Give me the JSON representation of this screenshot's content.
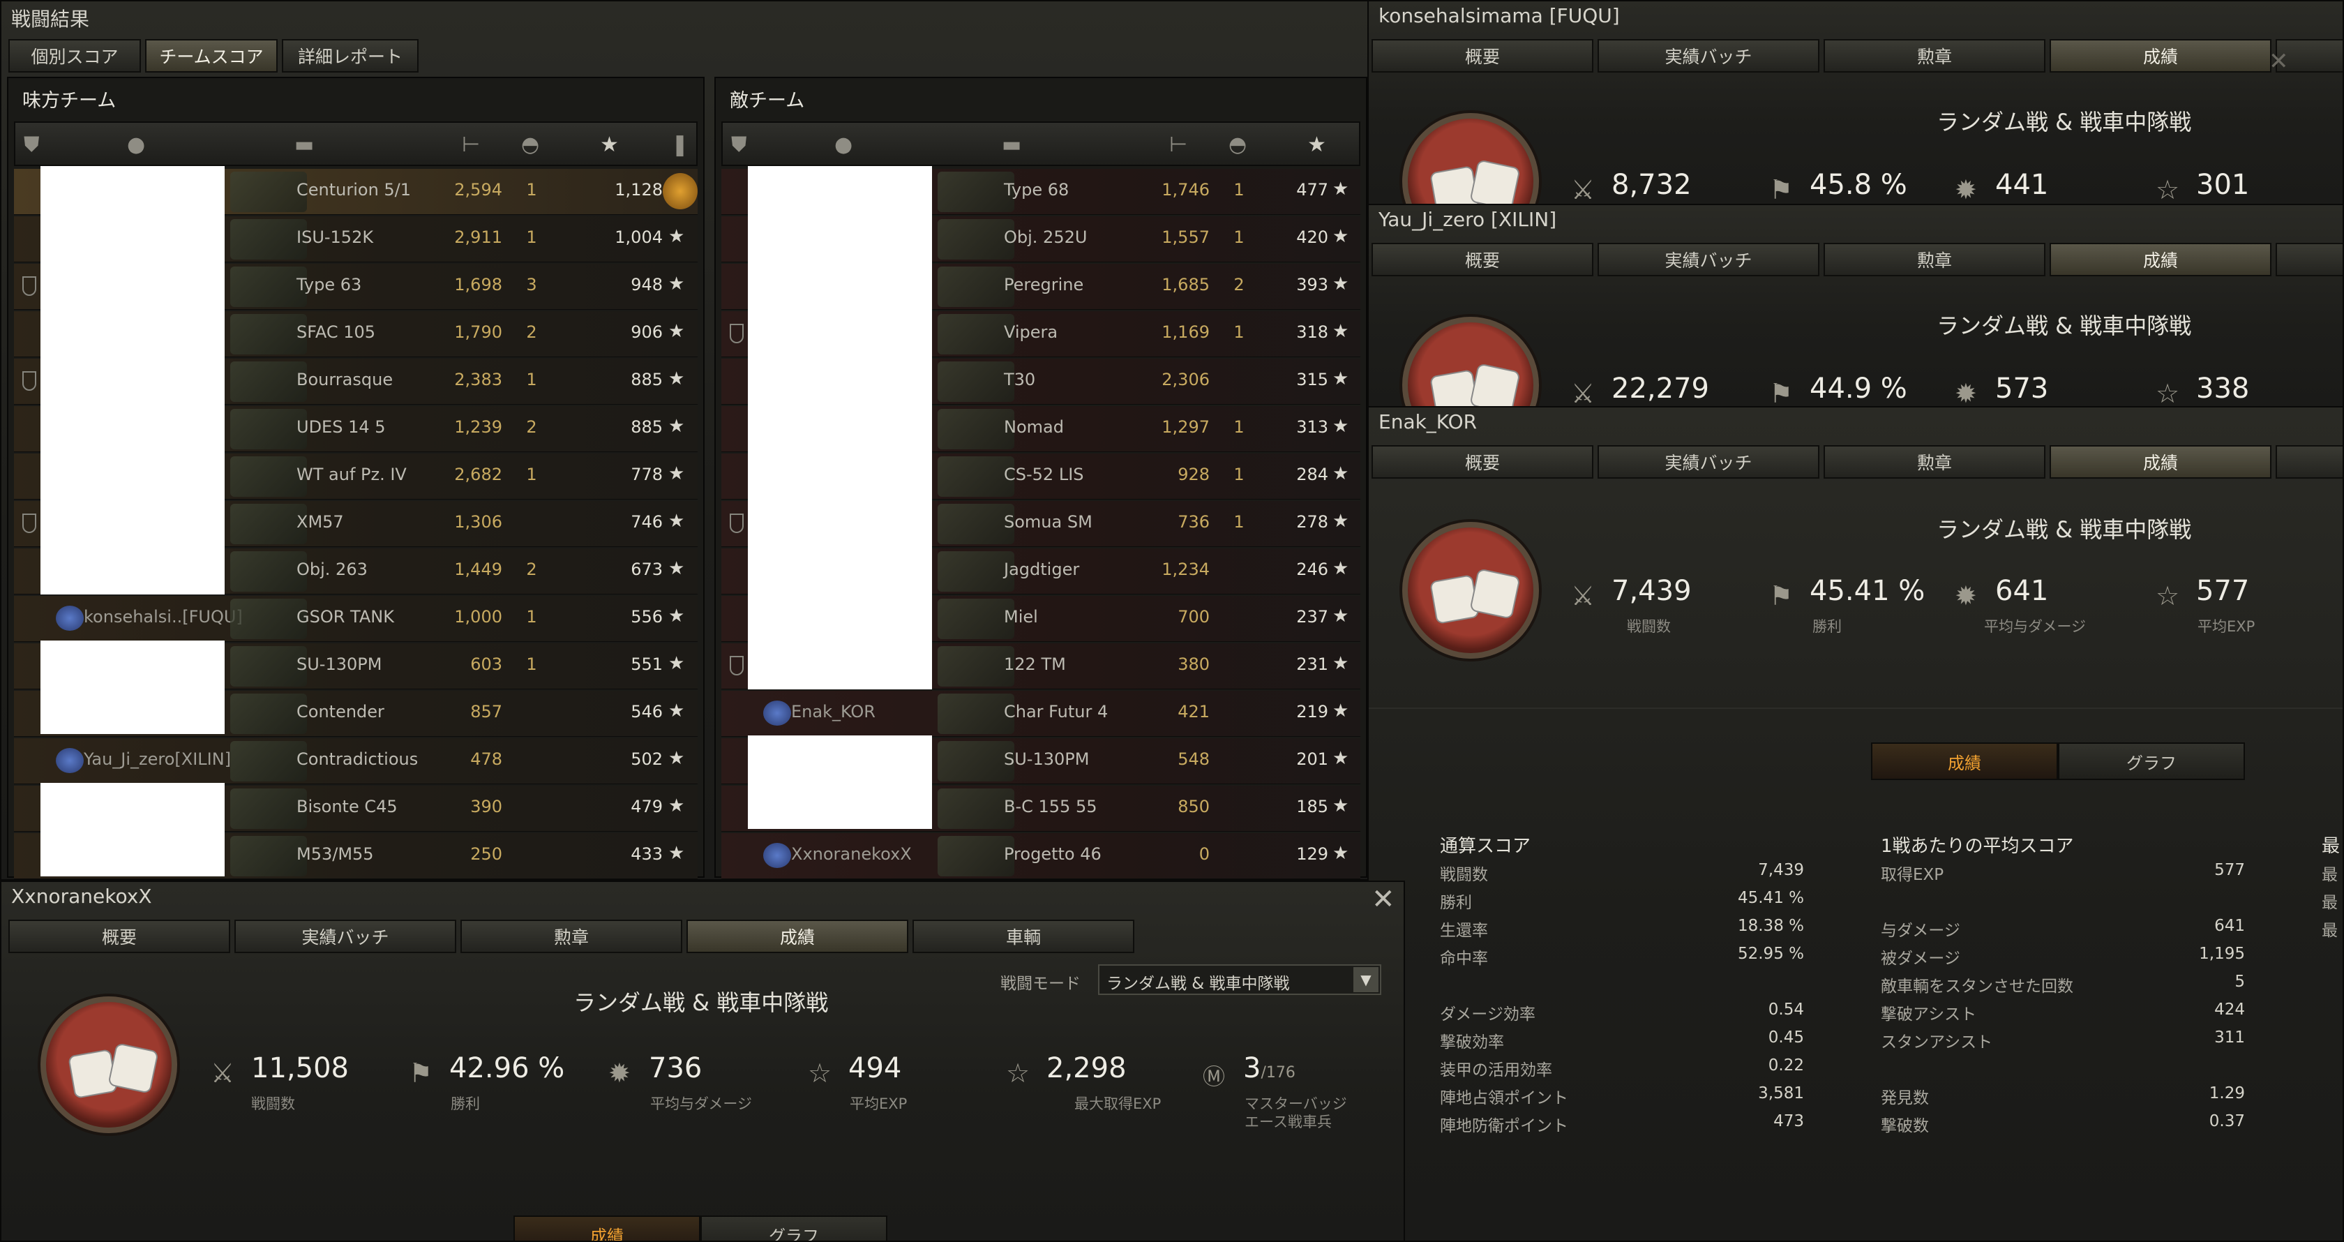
{
  "main": {
    "title": "戦闘結果",
    "tabs": [
      "個別スコア",
      "チームスコア",
      "詳細レポート"
    ],
    "active_tab": 1
  },
  "ally": {
    "title": "味方チーム",
    "rows": [
      {
        "player": "",
        "tank": "Centurion 5/1",
        "damage": "2,594",
        "kills": "1",
        "xp": "1,128",
        "medal": true,
        "hl": true
      },
      {
        "player": "",
        "tank": "ISU-152K",
        "damage": "2,911",
        "kills": "1",
        "xp": "1,004"
      },
      {
        "player": "",
        "tank": "Type 63",
        "damage": "1,698",
        "kills": "3",
        "xp": "948",
        "shield": true
      },
      {
        "player": "",
        "tank": "SFAC 105",
        "damage": "1,790",
        "kills": "2",
        "xp": "906"
      },
      {
        "player": "",
        "tank": "Bourrasque",
        "damage": "2,383",
        "kills": "1",
        "xp": "885",
        "shield": true
      },
      {
        "player": "",
        "tank": "UDES 14 5",
        "damage": "1,239",
        "kills": "2",
        "xp": "885"
      },
      {
        "player": "",
        "tank": "WT auf Pz. IV",
        "damage": "2,682",
        "kills": "1",
        "xp": "778"
      },
      {
        "player": "",
        "tank": "XM57",
        "damage": "1,306",
        "kills": "",
        "xp": "746",
        "shield": true
      },
      {
        "player": "",
        "tank": "Obj. 263",
        "damage": "1,449",
        "kills": "2",
        "xp": "673"
      },
      {
        "player": "konsehalsi..[FUQU]",
        "tank": "GSOR TANK",
        "damage": "1,000",
        "kills": "1",
        "xp": "556"
      },
      {
        "player": "",
        "tank": "SU-130PM",
        "damage": "603",
        "kills": "1",
        "xp": "551"
      },
      {
        "player": "",
        "tank": "Contender",
        "damage": "857",
        "kills": "",
        "xp": "546"
      },
      {
        "player": "Yau_Ji_zero[XILIN]",
        "tank": "Contradictious",
        "damage": "478",
        "kills": "",
        "xp": "502"
      },
      {
        "player": "",
        "tank": "Bisonte C45",
        "damage": "390",
        "kills": "",
        "xp": "479"
      },
      {
        "player": "",
        "tank": "M53/M55",
        "damage": "250",
        "kills": "",
        "xp": "433"
      }
    ]
  },
  "enemy": {
    "title": "敵チーム",
    "rows": [
      {
        "player": "",
        "tank": "Type 68",
        "damage": "1,746",
        "kills": "1",
        "xp": "477"
      },
      {
        "player": "",
        "tank": "Obj. 252U",
        "damage": "1,557",
        "kills": "1",
        "xp": "420"
      },
      {
        "player": "",
        "tank": "Peregrine",
        "damage": "1,685",
        "kills": "2",
        "xp": "393"
      },
      {
        "player": "",
        "tank": "Vipera",
        "damage": "1,169",
        "kills": "1",
        "xp": "318",
        "shield": true
      },
      {
        "player": "",
        "tank": "T30",
        "damage": "2,306",
        "kills": "",
        "xp": "315"
      },
      {
        "player": "",
        "tank": "Nomad",
        "damage": "1,297",
        "kills": "1",
        "xp": "313"
      },
      {
        "player": "",
        "tank": "CS-52 LIS",
        "damage": "928",
        "kills": "1",
        "xp": "284"
      },
      {
        "player": "",
        "tank": "Somua SM",
        "damage": "736",
        "kills": "1",
        "xp": "278",
        "shield": true
      },
      {
        "player": "",
        "tank": "Jagdtiger",
        "damage": "1,234",
        "kills": "",
        "xp": "246"
      },
      {
        "player": "",
        "tank": "Miel",
        "damage": "700",
        "kills": "",
        "xp": "237"
      },
      {
        "player": "",
        "tank": "122 TM",
        "damage": "380",
        "kills": "",
        "xp": "231",
        "shield": true
      },
      {
        "player": "Enak_KOR",
        "tank": "Char Futur 4",
        "damage": "421",
        "kills": "",
        "xp": "219"
      },
      {
        "player": "",
        "tank": "SU-130PM",
        "damage": "548",
        "kills": "",
        "xp": "201"
      },
      {
        "player": "",
        "tank": "B-C 155 55",
        "damage": "850",
        "kills": "",
        "xp": "185"
      },
      {
        "player": "XxnoranekoxX",
        "tank": "Progetto 46",
        "damage": "0",
        "kills": "",
        "xp": "129"
      }
    ]
  },
  "card1": {
    "name": "konsehalsimama [FUQU]",
    "tabs": [
      "概要",
      "実績バッチ",
      "勲章",
      "成績"
    ],
    "mode": "ランダム戦 & 戦車中隊戦",
    "battles": "8,732",
    "winrate": "45.8 %",
    "avgdmg": "441",
    "avgxp": "301"
  },
  "card2": {
    "name": "Yau_Ji_zero [XILIN]",
    "tabs": [
      "概要",
      "実績バッチ",
      "勲章",
      "成績"
    ],
    "mode": "ランダム戦 & 戦車中隊戦",
    "battles": "22,279",
    "winrate": "44.9 %",
    "avgdmg": "573",
    "avgxp": "338"
  },
  "card3": {
    "name": "Enak_KOR",
    "tabs": [
      "概要",
      "実績バッチ",
      "勲章",
      "成績"
    ],
    "mode": "ランダム戦 & 戦車中隊戦",
    "battles": "7,439",
    "winrate": "45.41 %",
    "avgdmg": "641",
    "avgxp": "577",
    "lbl_battles": "戦闘数",
    "lbl_win": "勝利",
    "lbl_dmg": "平均与ダメージ",
    "lbl_xp": "平均EXP",
    "subtabs": [
      "成績",
      "グラフ"
    ],
    "totals": {
      "title": "通算スコア",
      "rows": [
        {
          "k": "戦闘数",
          "v": "7,439"
        },
        {
          "k": "勝利",
          "v": "45.41 %"
        },
        {
          "k": "生還率",
          "v": "18.38 %"
        },
        {
          "k": "命中率",
          "v": "52.95 %"
        },
        {
          "k": "ダメージ効率",
          "v": "0.54"
        },
        {
          "k": "撃破効率",
          "v": "0.45"
        },
        {
          "k": "装甲の活用効率",
          "v": "0.22"
        },
        {
          "k": "陣地占領ポイント",
          "v": "3,581"
        },
        {
          "k": "陣地防衛ポイント",
          "v": "473"
        }
      ]
    },
    "avg": {
      "title": "1戦あたりの平均スコア",
      "rows": [
        {
          "k": "取得EXP",
          "v": "577"
        },
        {
          "k": "与ダメージ",
          "v": "641"
        },
        {
          "k": "被ダメージ",
          "v": "1,195"
        },
        {
          "k": "敵車輌をスタンさせた回数",
          "v": "5"
        },
        {
          "k": "撃破アシスト",
          "v": "424"
        },
        {
          "k": "スタンアシスト",
          "v": "311"
        },
        {
          "k": "発見数",
          "v": "1.29"
        },
        {
          "k": "撃破数",
          "v": "0.37"
        }
      ]
    },
    "max": {
      "title": "最",
      "rows": [
        "最",
        "最",
        "最"
      ]
    }
  },
  "card4": {
    "name": "XxnoranekoxX",
    "tabs": [
      "概要",
      "実績バッチ",
      "勲章",
      "成績",
      "車輌"
    ],
    "mode": "ランダム戦 & 戦車中隊戦",
    "mode_label": "戦闘モード",
    "mode_select": "ランダム戦 & 戦車中隊戦",
    "battles": "11,508",
    "winrate": "42.96 %",
    "avgdmg": "736",
    "avgxp": "494",
    "maxxp": "2,298",
    "mastery": "3",
    "mastery_total": "/176",
    "lbl_battles": "戦闘数",
    "lbl_win": "勝利",
    "lbl_dmg": "平均与ダメージ",
    "lbl_xp": "平均EXP",
    "lbl_maxxp": "最大取得EXP",
    "lbl_mastery1": "マスターバッジ",
    "lbl_mastery2": "エース戦車兵",
    "subtabs": [
      "成績",
      "グラフ"
    ]
  },
  "icons": {
    "close": "✕",
    "star": "★",
    "battles": "⚔",
    "win": "⚑",
    "dmg": "✹",
    "xp": "☆",
    "dropdown": "▼"
  }
}
